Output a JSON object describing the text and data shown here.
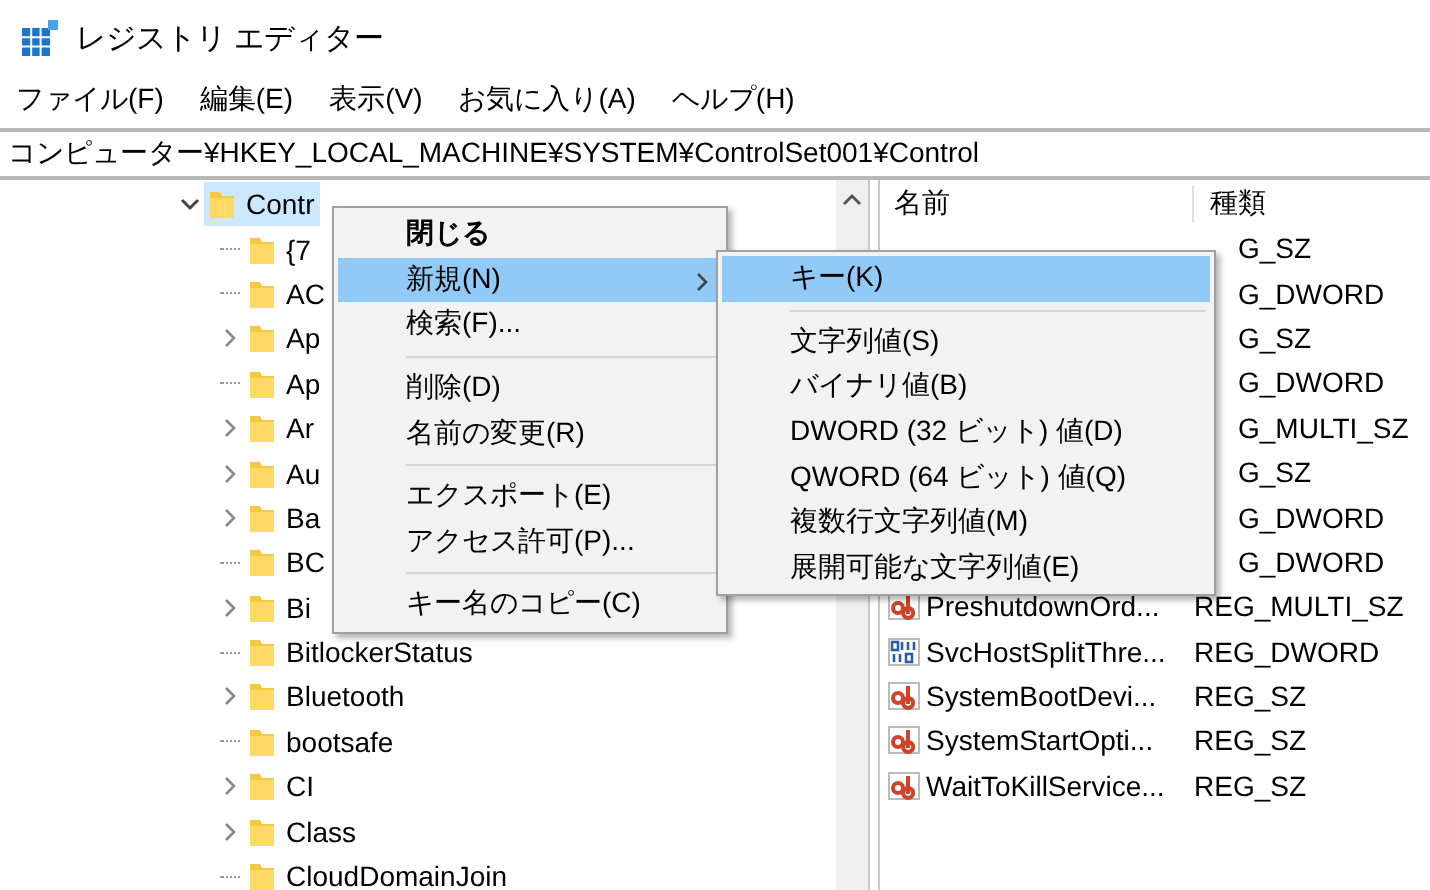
{
  "window": {
    "title": "レジストリ エディター"
  },
  "menu_bar": [
    "ファイル(F)",
    "編集(E)",
    "表示(V)",
    "お気に入り(A)",
    "ヘルプ(H)"
  ],
  "address": "コンピューター¥HKEY_LOCAL_MACHINE¥SYSTEM¥ControlSet001¥Control",
  "tree": {
    "items": [
      {
        "label": "Contr",
        "expanded": true,
        "selected": true,
        "children": [
          {
            "label": "{7",
            "has_children": false
          },
          {
            "label": "AC",
            "has_children": false
          },
          {
            "label": "Ap",
            "has_children": true
          },
          {
            "label": "Ap",
            "has_children": false
          },
          {
            "label": "Ar",
            "has_children": true
          },
          {
            "label": "Au",
            "has_children": true
          },
          {
            "label": "Ba",
            "has_children": true
          },
          {
            "label": "BC",
            "has_children": false
          },
          {
            "label": "Bi",
            "has_children": true
          },
          {
            "label": "BitlockerStatus",
            "has_children": false
          },
          {
            "label": "Bluetooth",
            "has_children": true
          },
          {
            "label": "bootsafe",
            "has_children": false
          },
          {
            "label": "CI",
            "has_children": true
          },
          {
            "label": "Class",
            "has_children": true
          },
          {
            "label": "CloudDomainJoin",
            "has_children": false
          }
        ]
      }
    ]
  },
  "values": {
    "columns": [
      "名前",
      "種類"
    ],
    "rows": [
      {
        "type": "G_SZ"
      },
      {
        "type": "G_DWORD"
      },
      {
        "type": "G_SZ"
      },
      {
        "type": "G_DWORD"
      },
      {
        "type": "G_MULTI_SZ"
      },
      {
        "type": "G_SZ"
      },
      {
        "type": "G_DWORD"
      },
      {
        "type": "G_DWORD"
      },
      {
        "name": "PreshutdownOrd...",
        "type": "REG_MULTI_SZ",
        "kind": "string"
      },
      {
        "name": "SvcHostSplitThre...",
        "type": "REG_DWORD",
        "kind": "binary"
      },
      {
        "name": "SystemBootDevi...",
        "type": "REG_SZ",
        "kind": "string"
      },
      {
        "name": "SystemStartOpti...",
        "type": "REG_SZ",
        "kind": "string"
      },
      {
        "name": "WaitToKillService...",
        "type": "REG_SZ",
        "kind": "string"
      }
    ]
  },
  "context_menu": {
    "items": [
      {
        "kind": "item",
        "label": "閉じる",
        "bold": true,
        "selected": false,
        "has_submenu": false
      },
      {
        "kind": "item",
        "label": "新規(N)",
        "bold": false,
        "selected": true,
        "has_submenu": true
      },
      {
        "kind": "item",
        "label": "検索(F)...",
        "bold": false,
        "selected": false,
        "has_submenu": false
      },
      {
        "kind": "separator"
      },
      {
        "kind": "item",
        "label": "削除(D)",
        "bold": false,
        "selected": false,
        "has_submenu": false
      },
      {
        "kind": "item",
        "label": "名前の変更(R)",
        "bold": false,
        "selected": false,
        "has_submenu": false
      },
      {
        "kind": "separator"
      },
      {
        "kind": "item",
        "label": "エクスポート(E)",
        "bold": false,
        "selected": false,
        "has_submenu": false
      },
      {
        "kind": "item",
        "label": "アクセス許可(P)...",
        "bold": false,
        "selected": false,
        "has_submenu": false
      },
      {
        "kind": "separator"
      },
      {
        "kind": "item",
        "label": "キー名のコピー(C)",
        "bold": false,
        "selected": false,
        "has_submenu": false
      }
    ]
  },
  "submenu": {
    "items": [
      {
        "kind": "item",
        "label": "キー(K)",
        "selected": true
      },
      {
        "kind": "separator"
      },
      {
        "kind": "item",
        "label": "文字列値(S)",
        "selected": false
      },
      {
        "kind": "item",
        "label": "バイナリ値(B)",
        "selected": false
      },
      {
        "kind": "item",
        "label": "DWORD (32 ビット) 値(D)",
        "selected": false
      },
      {
        "kind": "item",
        "label": "QWORD (64 ビット) 値(Q)",
        "selected": false
      },
      {
        "kind": "item",
        "label": "複数行文字列値(M)",
        "selected": false
      },
      {
        "kind": "item",
        "label": "展開可能な文字列値(E)",
        "selected": false
      }
    ]
  }
}
